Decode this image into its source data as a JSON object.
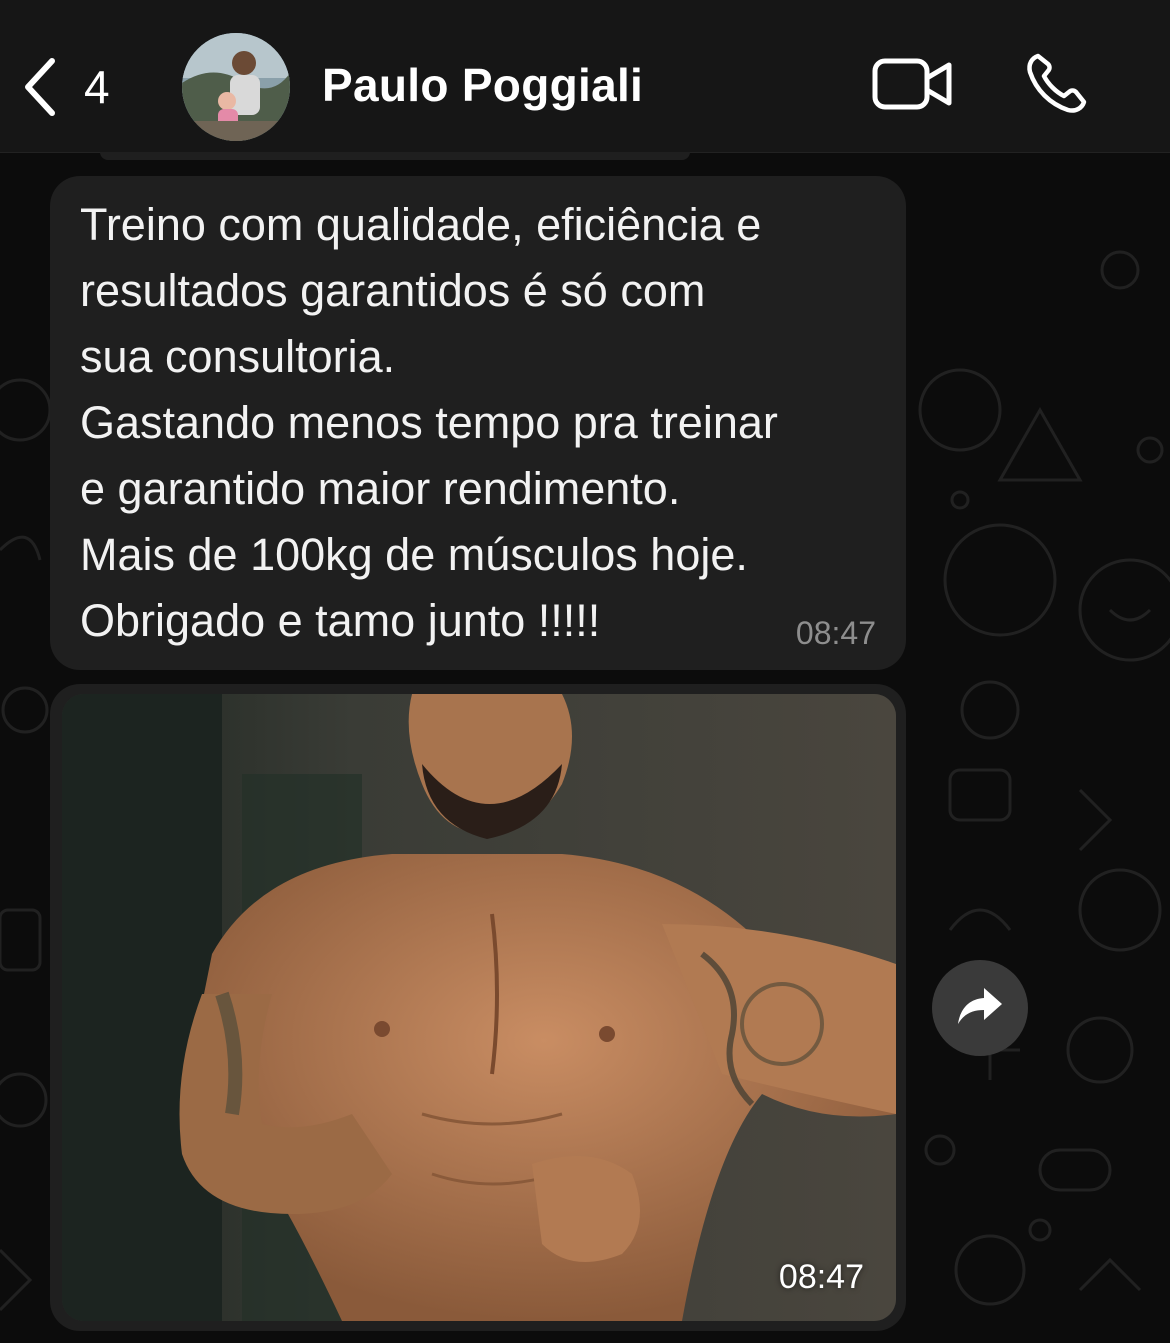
{
  "header": {
    "back_count": "4",
    "contact_name": "Paulo Poggiali",
    "icons": {
      "back": "chevron-left-icon",
      "video": "video-camera-icon",
      "call": "phone-icon"
    }
  },
  "messages": [
    {
      "type": "text",
      "lines": [
        "Treino com qualidade, eficiência e",
        "resultados garantidos é só com",
        "sua consultoria.",
        "Gastando menos tempo pra treinar",
        "e garantido maior rendimento.",
        "Mais de 100kg de músculos hoje.",
        "Obrigado e tamo junto !!!!!"
      ],
      "time": "08:47"
    },
    {
      "type": "image",
      "time": "08:47"
    }
  ],
  "actions": {
    "forward_icon": "share-forward-icon"
  },
  "colors": {
    "background": "#0c0c0c",
    "header": "#161616",
    "bubble": "#1f1f1f",
    "text": "#f2f2f2",
    "timestamp": "#8e8e8e"
  }
}
